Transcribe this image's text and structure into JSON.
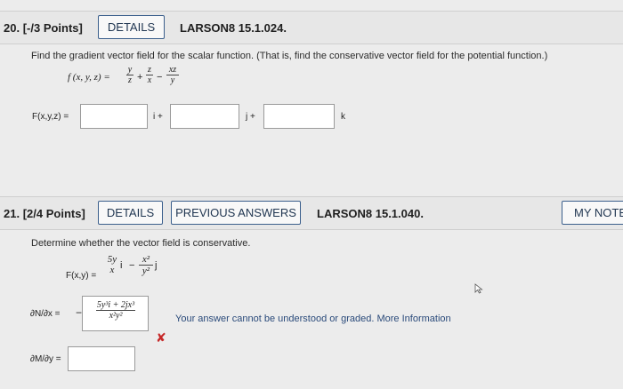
{
  "q20": {
    "number": "20.",
    "points": "[-/3 Points]",
    "details_label": "DETAILS",
    "reference": "LARSON8 15.1.024.",
    "prompt": "Find the gradient vector field for the scalar function. (That is, find the conservative vector field for the potential function.)",
    "function_lhs": "f (x, y, z) =",
    "function_terms": [
      {
        "num": "y",
        "den": "z"
      },
      {
        "num": "z",
        "den": "x"
      },
      {
        "num": "xz",
        "den": "y"
      }
    ],
    "function_ops": [
      "+",
      "−"
    ],
    "answer_label": "F(x,y,z) =",
    "unit_i": "i +",
    "unit_j": "j +",
    "unit_k": "k"
  },
  "q21": {
    "number": "21.",
    "points": "[2/4 Points]",
    "details_label": "DETAILS",
    "previous_answers_label": "PREVIOUS ANSWERS",
    "reference": "LARSON8 15.1.040.",
    "my_notes_label": "MY NOTES",
    "prompt": "Determine whether the vector field is conservative.",
    "field_lhs": "F(x,y) =",
    "field_term1": {
      "num": "5y",
      "den": "x",
      "suffix": "i"
    },
    "field_op": "−",
    "field_term2": {
      "num": "x²",
      "den": "y²",
      "suffix": "j"
    },
    "dN_label": "∂N/∂x =",
    "dN_prefix": "−",
    "dN_answer": {
      "num": "5y³i + 2jx³",
      "den": "x²y²"
    },
    "incorrect_mark": "✘",
    "feedback": "Your answer cannot be understood or graded.",
    "more_info": "More Information",
    "dM_label": "∂M/∂y ="
  },
  "colors": {
    "button_border": "#3b5f8c",
    "incorrect": "#c62828",
    "link": "#2a4a7a"
  }
}
